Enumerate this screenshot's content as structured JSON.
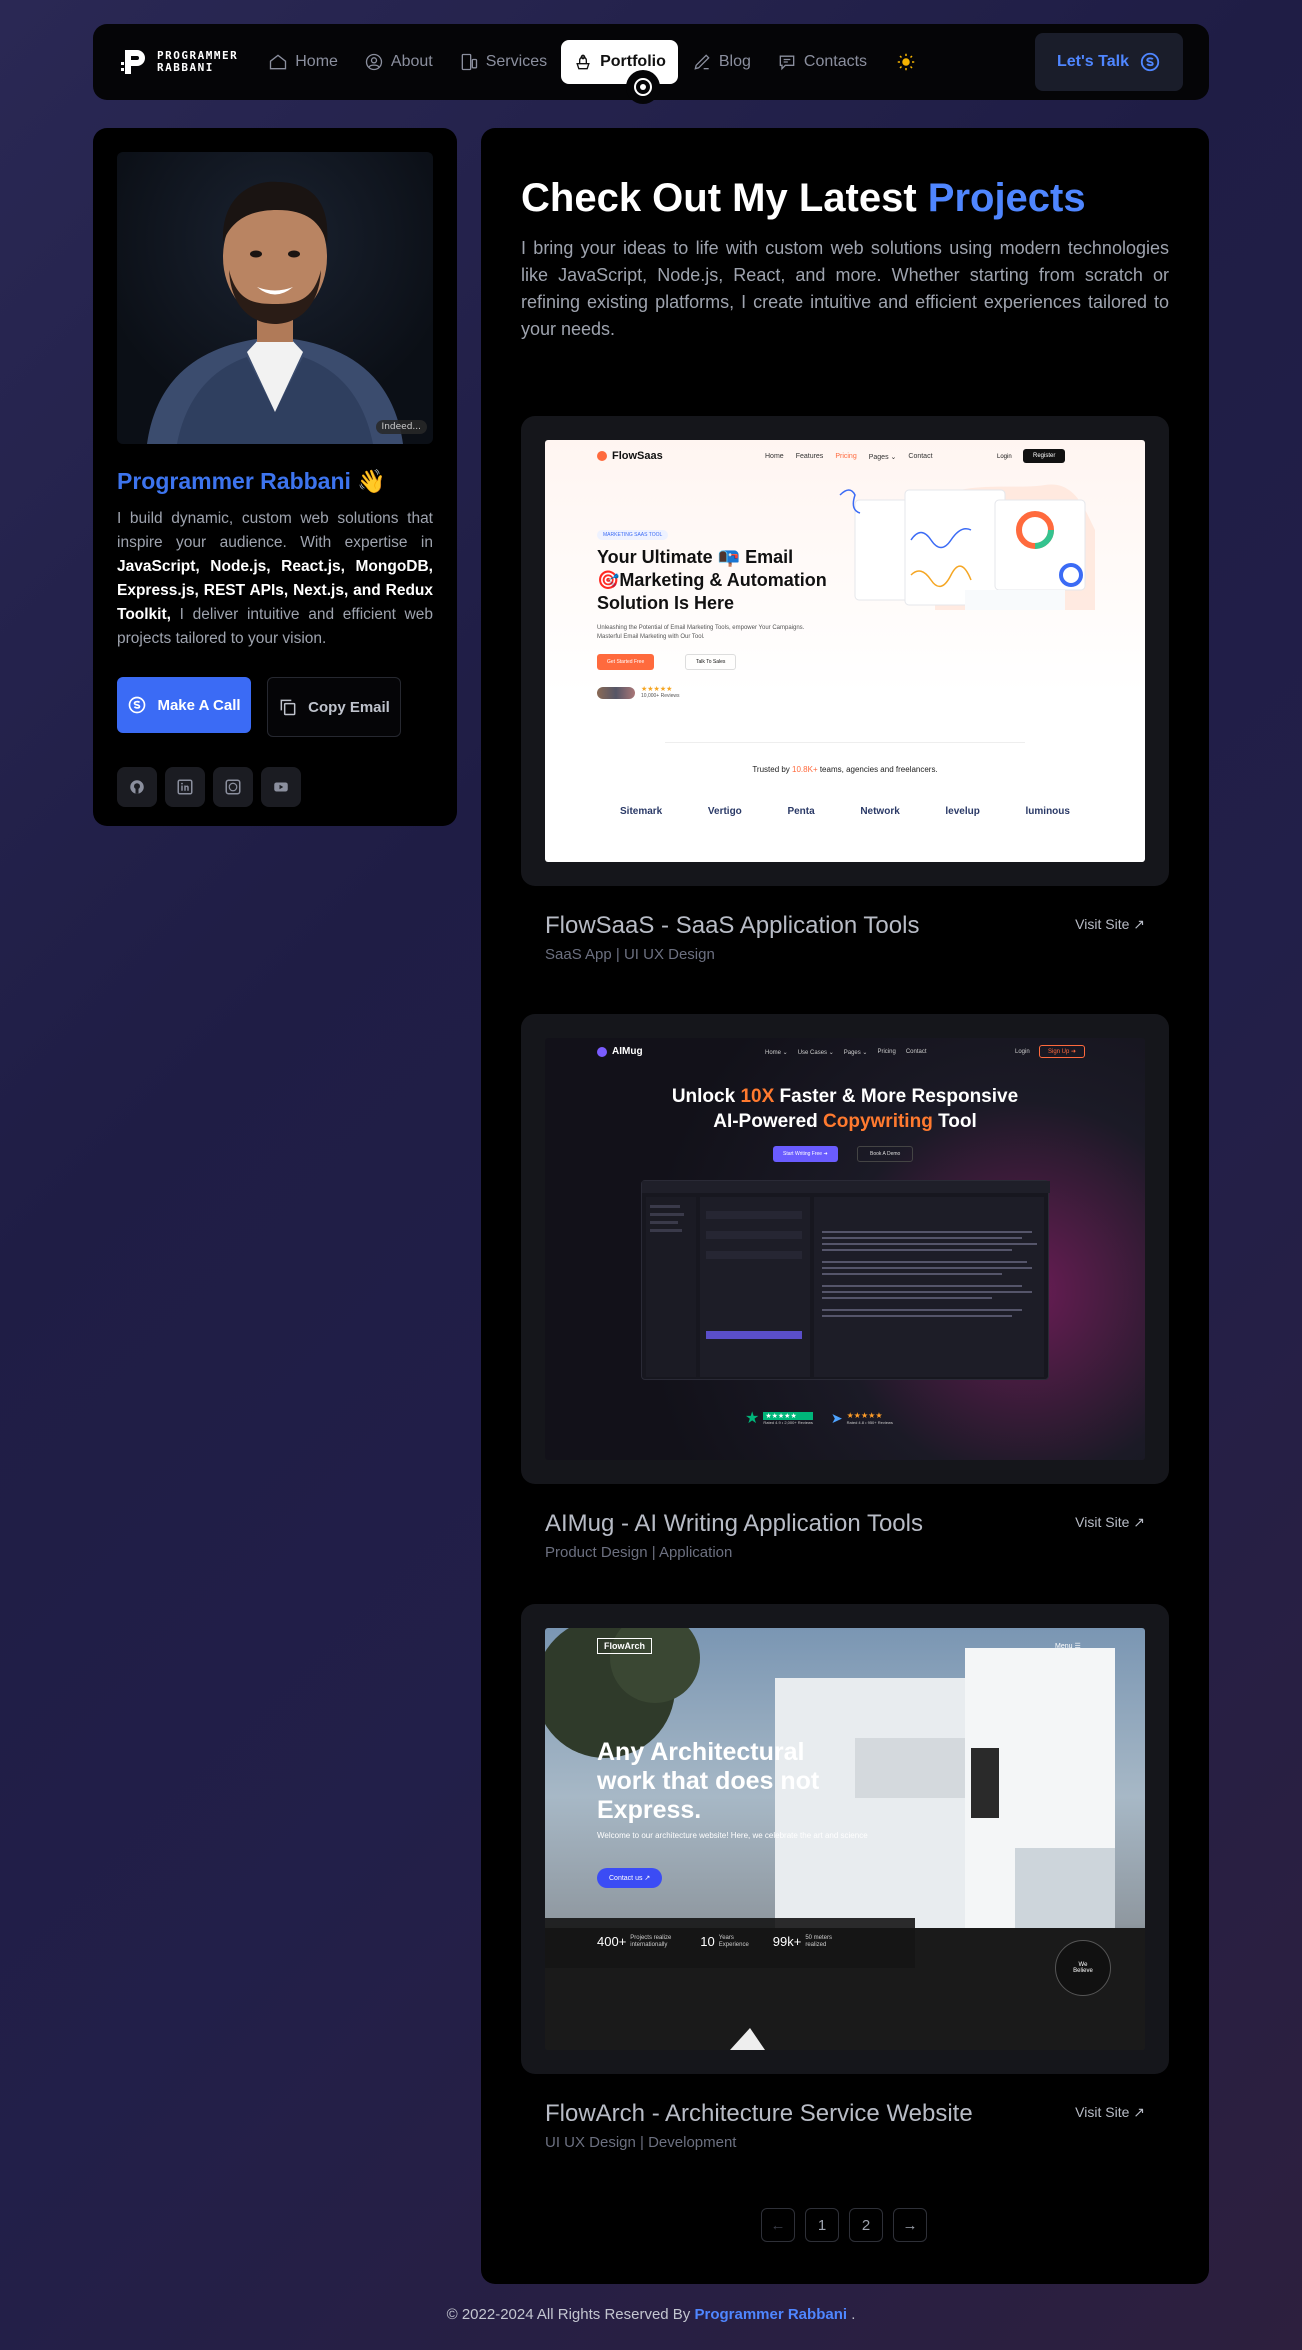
{
  "nav": {
    "logo_line1": "PROGRAMMER",
    "logo_line2": "RABBANI",
    "items": [
      {
        "label": "Home",
        "icon": "home-icon"
      },
      {
        "label": "About",
        "icon": "user-circle-icon"
      },
      {
        "label": "Services",
        "icon": "devices-icon"
      },
      {
        "label": "Portfolio",
        "icon": "portfolio-icon"
      },
      {
        "label": "Blog",
        "icon": "blog-icon"
      },
      {
        "label": "Contacts",
        "icon": "chat-icon"
      }
    ],
    "active": "Portfolio",
    "theme_icon": "sun-icon",
    "cta_label": "Let's Talk",
    "cta_icon": "skype-icon"
  },
  "sidebar": {
    "avatar_tag": "Indeed...",
    "name": "Programmer Rabbani",
    "name_emoji": "👋",
    "bio_prefix": "I build dynamic, custom web solutions that inspire your audience. With expertise in ",
    "bio_bold": "JavaScript, Node.js, React.js, MongoDB, Express.js, REST APIs, Next.js, and Redux Toolkit,",
    "bio_suffix": " I deliver intuitive and efficient web projects tailored to your vision.",
    "call_label": "Make A Call",
    "copy_label": "Copy Email",
    "socials": [
      "github-icon",
      "linkedin-icon",
      "whatsapp-icon",
      "youtube-icon"
    ]
  },
  "main": {
    "heading": "Check Out My Latest ",
    "heading_accent": "Projects",
    "intro": "I bring your ideas to life with custom web solutions using modern technologies like JavaScript, Node.js, React, and more. Whether starting from scratch or refining existing platforms, I create intuitive and efficient experiences tailored to your needs.",
    "projects": [
      {
        "title": "FlowSaaS - SaaS Application Tools",
        "subtitle": "SaaS App | UI UX Design",
        "visit": "Visit Site ↗"
      },
      {
        "title": "AIMug - AI Writing Application Tools",
        "subtitle": "Product Design | Application",
        "visit": "Visit Site ↗"
      },
      {
        "title": "FlowArch - Architecture Service Website",
        "subtitle": "UI UX Design | Development",
        "visit": "Visit Site ↗"
      }
    ],
    "pagination": {
      "prev": "←",
      "pages": [
        "1",
        "2"
      ],
      "next": "→"
    }
  },
  "shot1": {
    "brand": "FlowSaas",
    "menu": [
      "Home",
      "Features",
      "Pricing",
      "Pages ⌄",
      "Contact"
    ],
    "login": "Login",
    "register": "Register",
    "badge": "MARKETING SAAS TOOL",
    "headline1": "Your Ultimate 📭 Email",
    "headline2": "🎯Marketing & Automation",
    "headline3": "Solution Is Here",
    "desc": "Unleashing the Potential of Email Marketing Tools, empower Your Campaigns. Masterful Email Marketing with Our Tool.",
    "btn_primary": "Get Started Free",
    "btn_secondary": "Talk To Sales",
    "stars": "★★★★★",
    "reviews": "10,000+ Reviews",
    "trusted_prefix": "Trusted by ",
    "trusted_count": "10.8K+",
    "trusted_suffix": " teams, agencies and freelancers.",
    "partners": [
      "Sitemark",
      "Vertigo",
      "Penta",
      "Network",
      "levelup",
      "luminous"
    ]
  },
  "shot2": {
    "brand": "AIMug",
    "menu": [
      "Home ⌄",
      "Use Cases ⌄",
      "Pages ⌄",
      "Pricing",
      "Contact"
    ],
    "login": "Login",
    "signup": "Sign Up ➜",
    "headline_a": "Unlock ",
    "headline_b": "10X",
    "headline_c": " Faster & More Responsive",
    "headline_d": "AI-Powered ",
    "headline_e": "Copywriting",
    "headline_f": " Tool",
    "btn_primary": "Start Writing Free ➜",
    "btn_secondary": "Book A Demo",
    "rating1": "Rated 4.9 • 2,000+ Reviews",
    "rating2": "Rated 4.8 • 950+ Reviews"
  },
  "shot3": {
    "brand": "FlowArch",
    "menu": "Menu ☰",
    "headline1": "Any Architectural",
    "headline2": "work that does not",
    "headline3": "Express.",
    "desc": "Welcome to our architecture website! Here, we celebrate the art and science",
    "cta": "Contact us ↗",
    "stats": [
      {
        "num": "400+",
        "label": "Projects realize internationally"
      },
      {
        "num": "10",
        "label": "Years Experience"
      },
      {
        "num": "99k+",
        "label": "50 meters realized"
      }
    ],
    "badge": "We Believe"
  },
  "footer": {
    "prefix": "© 2022-2024 All Rights Reserved By ",
    "brand": "Programmer Rabbani",
    "suffix": " ."
  },
  "colors": {
    "accent": "#4f86ff",
    "call_button": "#3b6bf5",
    "panel": "#000000",
    "card": "#15161b"
  }
}
